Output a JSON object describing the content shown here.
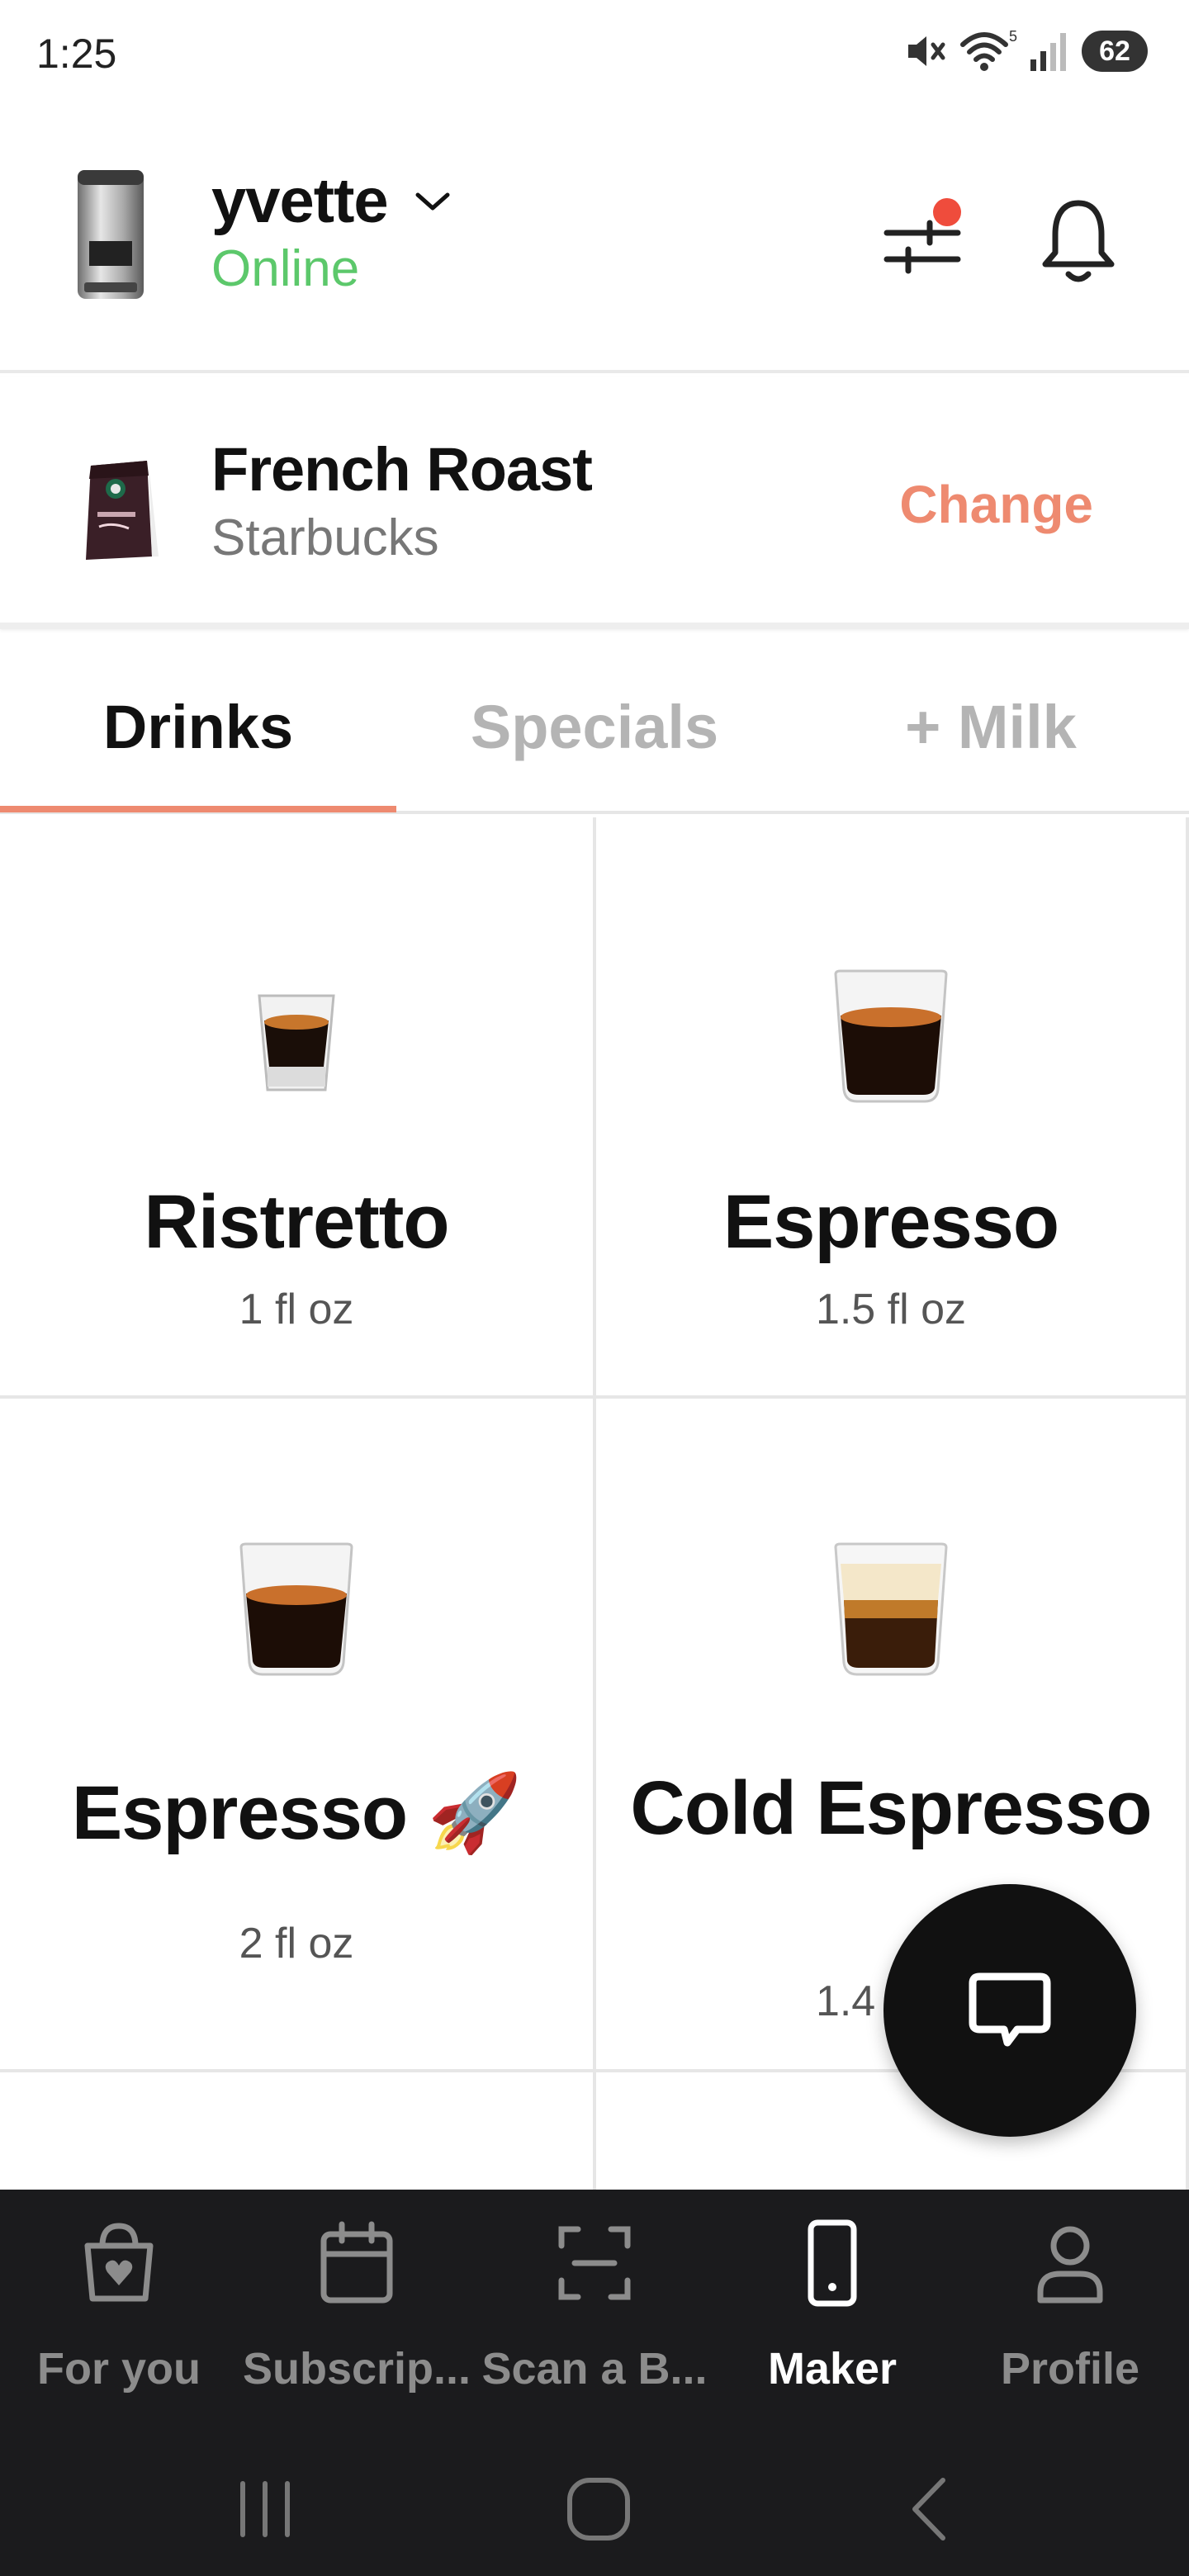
{
  "status_bar": {
    "time": "1:25",
    "wifi_label": "5",
    "battery": "62"
  },
  "device": {
    "name": "yvette",
    "status": "Online",
    "status_color": "#5cc86b"
  },
  "coffee": {
    "name": "French Roast",
    "brand": "Starbucks",
    "change_label": "Change",
    "accent_color": "#ee8a70"
  },
  "tabs": [
    {
      "label": "Drinks",
      "active": true
    },
    {
      "label": "Specials",
      "active": false
    },
    {
      "label": "+ Milk",
      "active": false
    }
  ],
  "drinks": [
    {
      "name": "Ristretto",
      "size": "1 fl oz"
    },
    {
      "name": "Espresso",
      "size": "1.5 fl oz"
    },
    {
      "name": "Espresso 🚀",
      "size": "2 fl oz"
    },
    {
      "name": "Cold Espresso",
      "size": "1.4 fl oz"
    }
  ],
  "bottom_nav": [
    {
      "label": "For you",
      "icon": "bag-heart-icon"
    },
    {
      "label": "Subscrip...",
      "icon": "calendar-icon"
    },
    {
      "label": "Scan a B...",
      "icon": "scan-icon"
    },
    {
      "label": "Maker",
      "icon": "phone-icon",
      "active": true
    },
    {
      "label": "Profile",
      "icon": "person-icon"
    }
  ],
  "system_nav": [
    "recents-icon",
    "home-icon",
    "back-icon"
  ]
}
